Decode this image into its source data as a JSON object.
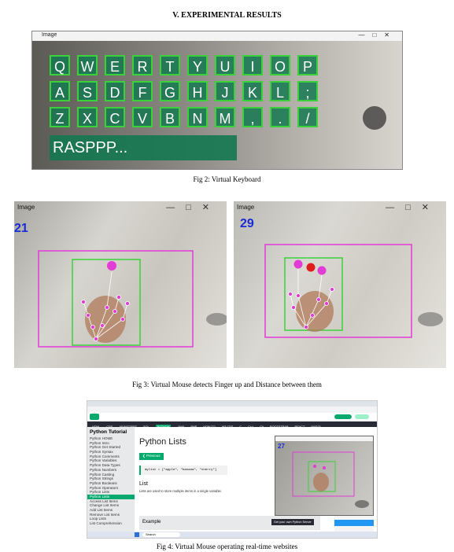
{
  "section_heading": "V.        EXPERIMENTAL RESULTS",
  "fig2": {
    "window_title": "Image",
    "keyboard_rows": [
      [
        "Q",
        "W",
        "E",
        "R",
        "T",
        "Y",
        "U",
        "I",
        "O",
        "P"
      ],
      [
        "A",
        "S",
        "D",
        "F",
        "G",
        "H",
        "J",
        "K",
        "L",
        ";"
      ],
      [
        "Z",
        "X",
        "C",
        "V",
        "B",
        "N",
        "M",
        ",",
        ".",
        "/"
      ]
    ],
    "typed_text": "RASPPP...",
    "caption": "Fig 2: Virtual Keyboard"
  },
  "fig3": {
    "left": {
      "window_title": "Image",
      "fps": "21"
    },
    "right": {
      "window_title": "Image",
      "fps": "29"
    },
    "caption": "Fig 3: Virtual Mouse detects Finger up and Distance between them"
  },
  "fig4": {
    "page_title": "Python Lists",
    "sidebar_heading": "Python Tutorial",
    "sidebar_items": [
      "Python HOME",
      "Python Intro",
      "Python Get Started",
      "Python Syntax",
      "Python Comments",
      "Python Variables",
      "Python Data Types",
      "Python Numbers",
      "Python Casting",
      "Python Strings",
      "Python Booleans",
      "Python Operators",
      "Python Lists",
      "Python Lists",
      "Access List Items",
      "Change List Items",
      "Add List Items",
      "Remove List Items",
      "Loop Lists",
      "List Comprehension"
    ],
    "active_index": 13,
    "previous_button": "❮ Previous",
    "code_example": "mylist = [\"apple\", \"banana\", \"cherry\"]",
    "section_list": "List",
    "body_line1": "Lists are used to store multiple items in a single variable.",
    "section_example": "Example",
    "server_button": "Get your own Python Server",
    "nav_tabs": [
      "HTML",
      "CSS",
      "JAVASCRIPT",
      "SQL",
      "PYTHON",
      "JAVA",
      "PHP",
      "HOW TO",
      "W3.CSS",
      "C",
      "C++",
      "C#",
      "BOOTSTRAP",
      "REACT",
      "MYSQL"
    ],
    "overlay_fps": "27",
    "taskbar_search": "Search",
    "caption": "Fig 4: Virtual Mouse operating real-time websites"
  },
  "colors": {
    "key_fill": "#14784f",
    "key_border": "#3bd13b",
    "box_magenta": "#e23bd6",
    "box_green": "#3bd13b",
    "fps_blue": "#1a2bd6",
    "w3_green": "#04aa6d"
  }
}
